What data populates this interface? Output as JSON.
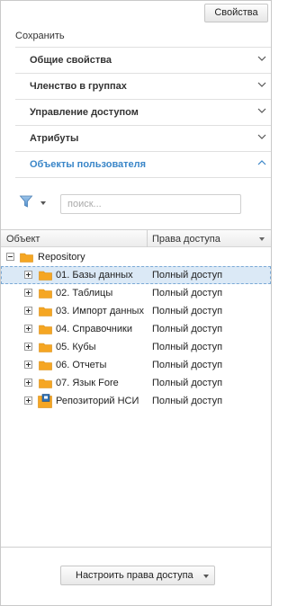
{
  "header": {
    "properties_button": "Свойства",
    "save_label": "Сохранить"
  },
  "sections": [
    {
      "label": "Общие свойства",
      "expanded": false
    },
    {
      "label": "Членство в группах",
      "expanded": false
    },
    {
      "label": "Управление доступом",
      "expanded": false
    },
    {
      "label": "Атрибуты",
      "expanded": false
    },
    {
      "label": "Объекты пользователя",
      "expanded": true
    }
  ],
  "toolbar": {
    "filter_icon": "funnel-icon",
    "search_placeholder": "поиск...",
    "search_value": ""
  },
  "grid": {
    "columns": [
      "Объект",
      "Права доступа"
    ],
    "root": {
      "name": "Repository",
      "expanded": true
    },
    "rows": [
      {
        "name": "01. Базы данных",
        "access": "Полный доступ",
        "icon": "folder-icon",
        "selected": true
      },
      {
        "name": "02. Таблицы",
        "access": "Полный доступ",
        "icon": "folder-icon",
        "selected": false
      },
      {
        "name": "03. Импорт данных",
        "access": "Полный доступ",
        "icon": "folder-icon",
        "selected": false
      },
      {
        "name": "04. Справочники",
        "access": "Полный доступ",
        "icon": "folder-icon",
        "selected": false
      },
      {
        "name": "05. Кубы",
        "access": "Полный доступ",
        "icon": "folder-icon",
        "selected": false
      },
      {
        "name": "06. Отчеты",
        "access": "Полный доступ",
        "icon": "folder-icon",
        "selected": false
      },
      {
        "name": "07. Язык Fore",
        "access": "Полный доступ",
        "icon": "folder-icon",
        "selected": false
      },
      {
        "name": "Репозиторий НСИ",
        "access": "Полный доступ",
        "icon": "repository-nsi-icon",
        "selected": false
      }
    ]
  },
  "footer": {
    "configure_button": "Настроить права доступа"
  },
  "colors": {
    "accent": "#3a86c8",
    "folder": "#f5a623",
    "selection": "#dbe9f6"
  }
}
